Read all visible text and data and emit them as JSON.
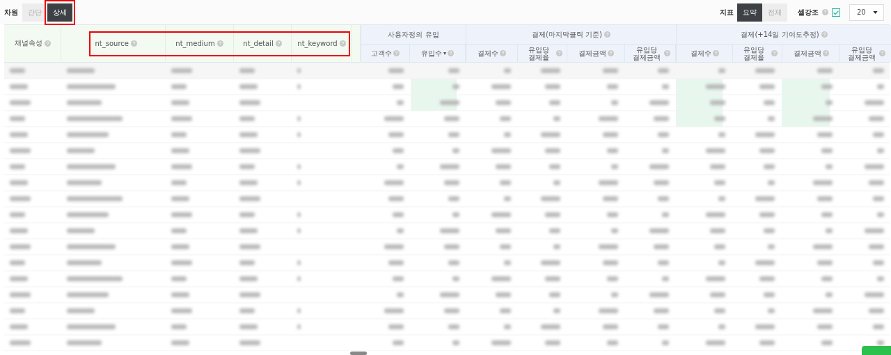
{
  "dimension": {
    "label": "차원",
    "annotated": true,
    "options": [
      {
        "label": "간단",
        "selected": false
      },
      {
        "label": "상세",
        "selected": true
      }
    ]
  },
  "metrics": {
    "label": "지표",
    "options": [
      {
        "label": "요약",
        "selected": true
      },
      {
        "label": "전체",
        "selected": false
      }
    ]
  },
  "cell_highlight": {
    "label": "셀강조",
    "checked": true
  },
  "page_size": {
    "value": "20"
  },
  "table": {
    "dimension_columns": [
      {
        "label": "채널속성"
      }
    ],
    "custom_params": {
      "annotated": true,
      "columns": [
        {
          "label": "nt_source"
        },
        {
          "label": "nt_medium"
        },
        {
          "label": "nt_detail"
        },
        {
          "label": "nt_keyword"
        }
      ]
    },
    "groups": [
      {
        "title": "사용자정의 유입",
        "columns": [
          {
            "label": "고객수"
          },
          {
            "label": "유입수",
            "sort_indicator": "▾"
          }
        ]
      },
      {
        "title": "결제(마지막클릭 기준)",
        "columns": [
          {
            "label": "결제수"
          },
          {
            "label": "유입당 결제율"
          },
          {
            "label": "결제금액"
          },
          {
            "label": "유입당 결제금액"
          }
        ]
      },
      {
        "title": "결제(+14일 기여도추정)",
        "columns": [
          {
            "label": "결제수"
          },
          {
            "label": "유입당 결제율"
          },
          {
            "label": "결제금액"
          },
          {
            "label": "유입당 결제금액"
          }
        ]
      }
    ]
  }
}
